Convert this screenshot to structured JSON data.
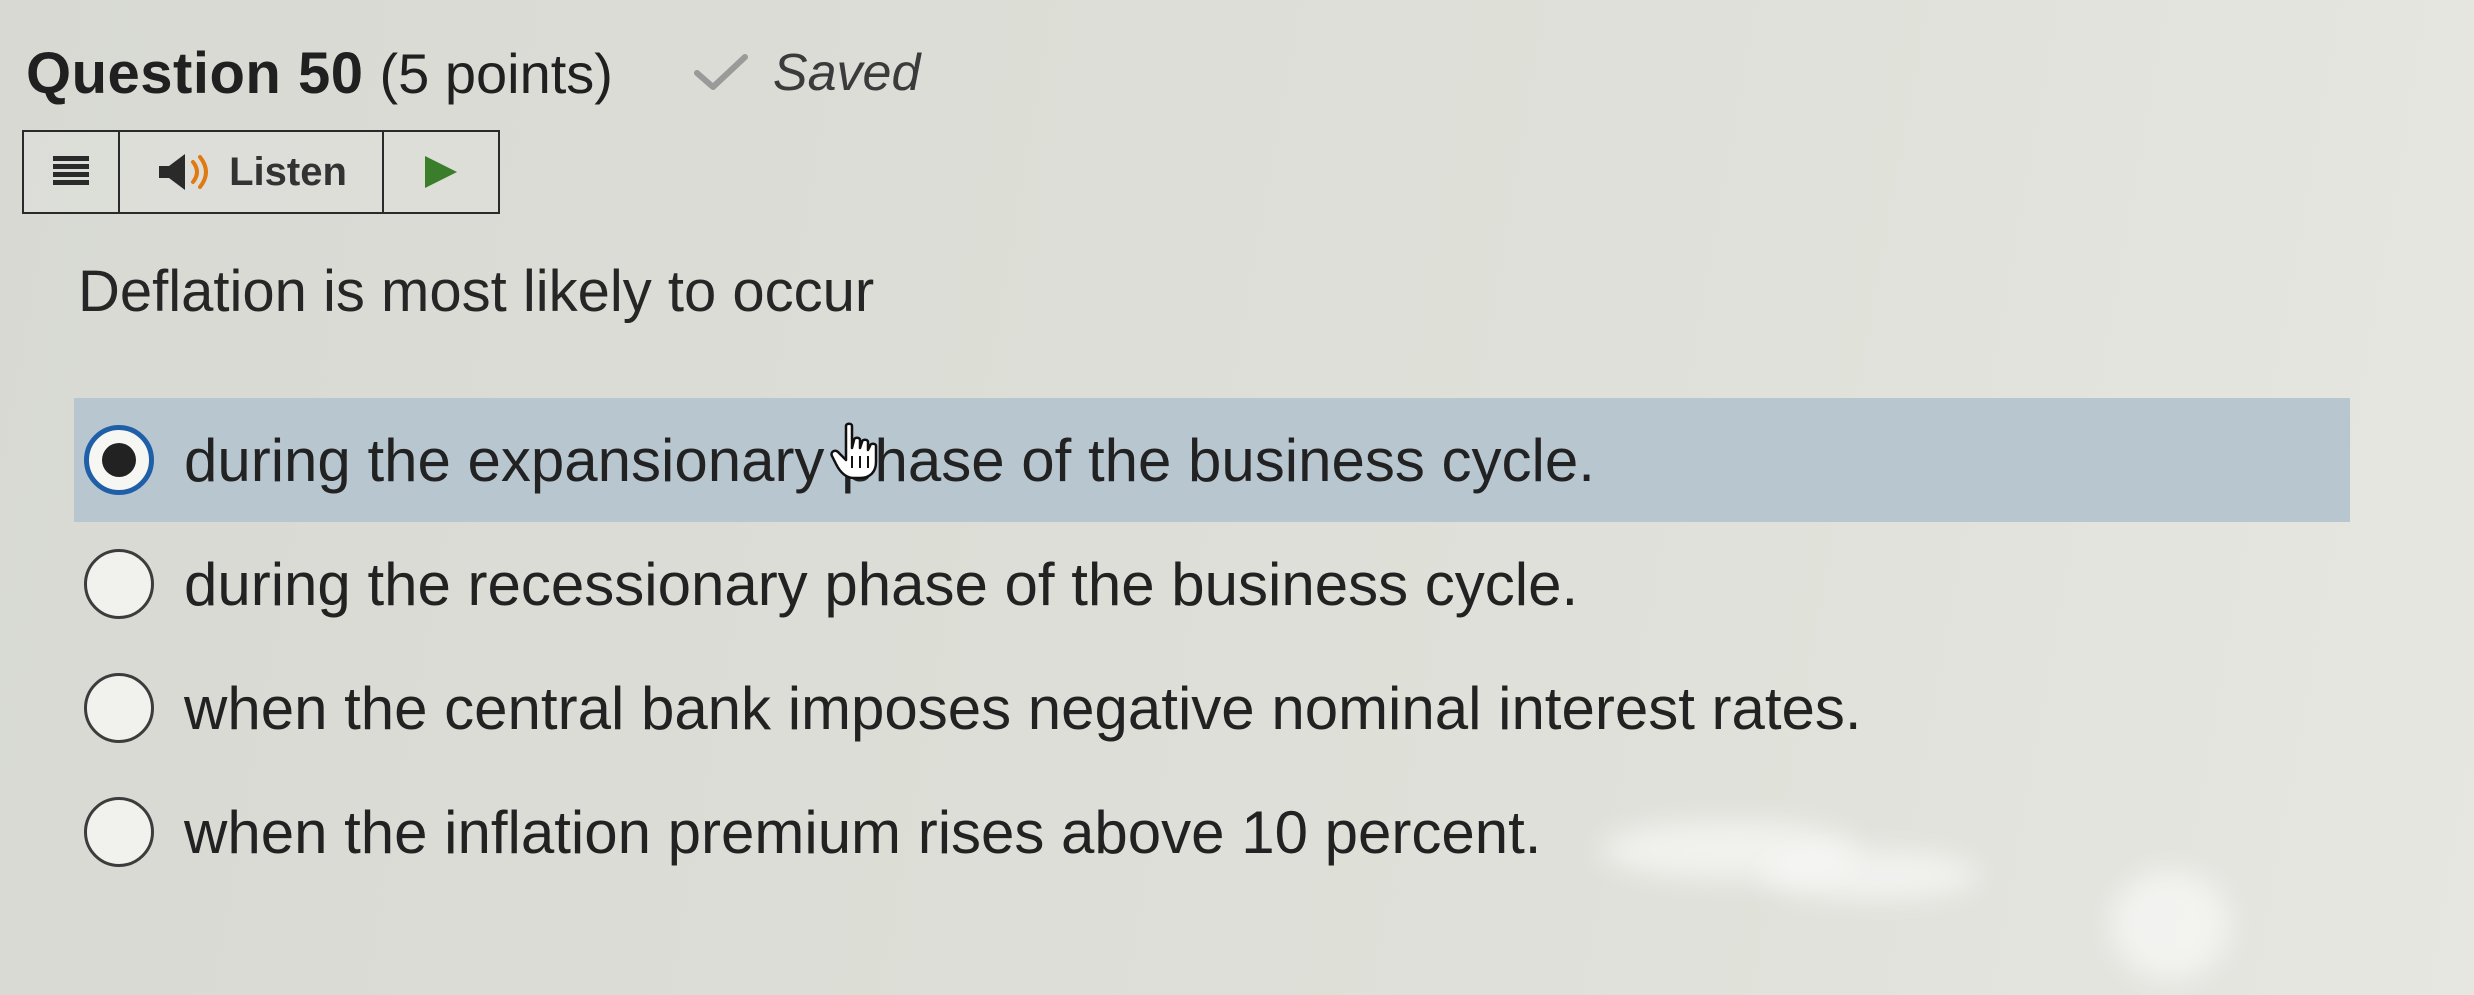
{
  "question": {
    "title": "Question 50",
    "points": "(5 points)",
    "status": "Saved",
    "text": "Deflation is most likely to occur"
  },
  "toolbar": {
    "listen_label": "Listen"
  },
  "icons": {
    "status": "checkmark-icon",
    "menu": "menu-icon",
    "speaker": "speaker-icon",
    "play": "play-icon"
  },
  "colors": {
    "selected_background": "#b8c6d0",
    "radio_checked_border": "#1f5fa8",
    "play_green": "#3a7d2a"
  },
  "options": [
    {
      "label": "during the expansionary phase of the business cycle.",
      "selected": true
    },
    {
      "label": "during the recessionary phase of the business cycle.",
      "selected": false
    },
    {
      "label": "when the central bank imposes negative nominal interest rates.",
      "selected": false
    },
    {
      "label": "when the inflation premium rises above 10 percent.",
      "selected": false
    }
  ]
}
